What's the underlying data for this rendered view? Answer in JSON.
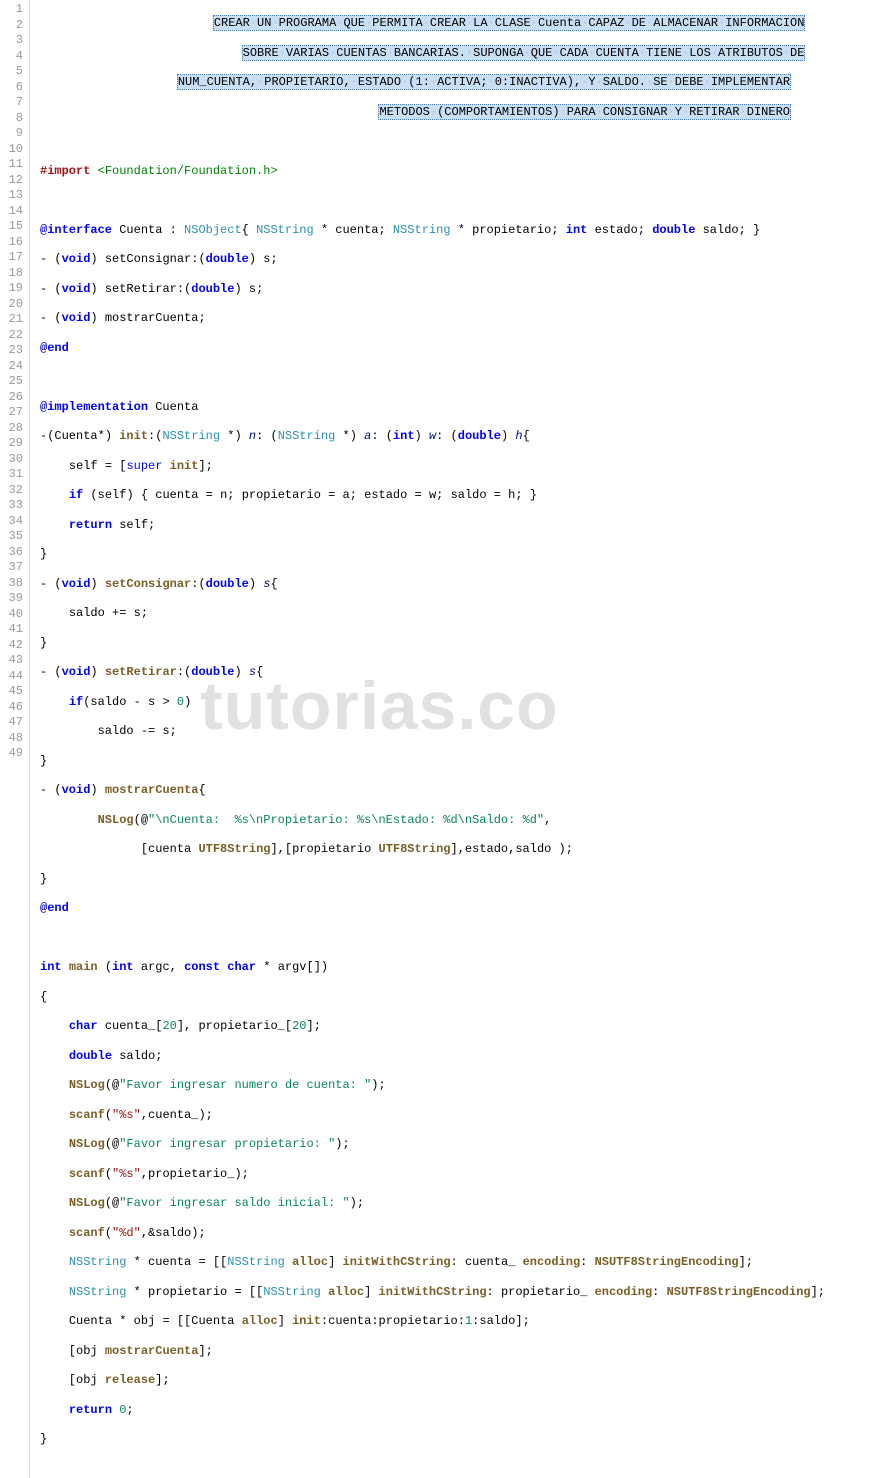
{
  "watermark": "tutorias.co",
  "gutter": [
    "1",
    "2",
    "3",
    "4",
    "5",
    "6",
    "7",
    "8",
    "9",
    "10",
    "11",
    "12",
    "13",
    "14",
    "15",
    "16",
    "17",
    "18",
    "19",
    "20",
    "21",
    "22",
    "23",
    "24",
    "25",
    "26",
    "27",
    "28",
    "29",
    "30",
    "31",
    "32",
    "33",
    "34",
    "35",
    "36",
    "37",
    "38",
    "39",
    "40",
    "41",
    "42",
    "43",
    "44",
    "45",
    "46",
    "47",
    "48",
    "49"
  ],
  "comment": {
    "l1": "CREAR·UN·PROGRAMA·QUE·PERMITA·CREAR·LA·CLASE·Cuenta·CAPAZ·DE·ALMACENAR·INFORMACION",
    "l2": "SOBRE·VARIAS·CUENTAS·BANCARIAS.·SUPONGA·QUE·CADA·CUENTA·TIENE·LOS·ATRIBUTOS·DE",
    "l3": "NUM_CUENTA,·PROPIETARIO,·ESTADO·(1:·ACTIVA;·0:INACTIVA),·Y·SALDO.·SE·DEBE·IMPLEMENTAR",
    "l4": "METODOS·(COMPORTAMIENTOS)·PARA·CONSIGNAR·Y·RETIRAR·DINERO"
  },
  "tok": {
    "import": "#import",
    "foundation": "<Foundation/Foundation.h>",
    "interface": "@interface",
    "cuenta": "Cuenta",
    "nsobject": "NSObject",
    "nsstring": "NSString",
    "int": "int",
    "double": "double",
    "void": "void",
    "char": "char",
    "const": "const",
    "if": "if",
    "return": "return",
    "super": "super",
    "end": "@end",
    "implementation": "@implementation",
    "init": "init",
    "self": "self",
    "alloc": "alloc",
    "release": "release",
    "main": "main",
    "nslog": "NSLog",
    "scanf": "scanf",
    "utf8string": "UTF8String",
    "initwithcstring": "initWithCString",
    "encoding": "encoding",
    "nsutf8enc": "NSUTF8StringEncoding",
    "setconsignar": "setConsignar",
    "setretirar": "setRetirar",
    "mostrarcuenta": "mostrarCuenta",
    "cuenta_v": "cuenta",
    "propietario_v": "propietario",
    "estado_v": "estado",
    "saldo_v": "saldo",
    "n": "n",
    "a": "a",
    "w": "w",
    "h": "h",
    "s": "s",
    "argc": "argc",
    "argv": "argv",
    "cuenta_": "cuenta_",
    "propietario_": "propietario_",
    "obj": "obj",
    "twenty": "20",
    "zero": "0",
    "one": "1"
  },
  "str": {
    "nslog_cuenta": "\"\\nCuenta:  %s\\nPropietario: %s\\nEstado: %d\\nSaldo: %d\"",
    "numcuenta": "\"Favor ingresar numero de cuenta: \"",
    "propietario": "\"Favor ingresar propietario: \"",
    "saldo": "\"Favor ingresar saldo inicial: \"",
    "fmt_s": "\"%s\"",
    "fmt_d": "\"%d\""
  }
}
